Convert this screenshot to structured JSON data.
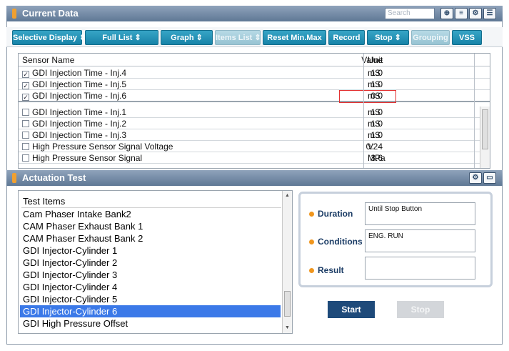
{
  "current": {
    "title": "Current Data",
    "search_placeholder": "Search",
    "icons": [
      "zoom-in-icon",
      "list-icon",
      "setup-icon",
      "layout-icon"
    ],
    "setup_glyph": "⚙",
    "buttons": {
      "selective": "Selective Display ⇕",
      "fulllist": "Full List ⇕",
      "graph": "Graph ⇕",
      "itemslist": "Items List ⇕",
      "reset": "Reset Min.Max",
      "record": "Record",
      "stop": "Stop ⇕",
      "grouping": "Grouping",
      "vss": "VSS"
    },
    "headers": {
      "sensor": "Sensor Name",
      "value": "Value",
      "unit": "Unit"
    },
    "rows": [
      {
        "checked": "✓",
        "name": "GDI Injection Time - Inj.4",
        "value": "1.0",
        "unit": "mS"
      },
      {
        "checked": "✓",
        "name": "GDI Injection Time - Inj.5",
        "value": "1.0",
        "unit": "mS"
      },
      {
        "checked": "✓",
        "name": "GDI Injection Time - Inj.6",
        "value": "0.0",
        "unit": "mS"
      },
      {
        "checked": "",
        "name": "GDI Injection Time - Inj.1",
        "value": "1.0",
        "unit": "mS"
      },
      {
        "checked": "",
        "name": "GDI Injection Time - Inj.2",
        "value": "1.0",
        "unit": "mS"
      },
      {
        "checked": "",
        "name": "GDI Injection Time - Inj.3",
        "value": "1.0",
        "unit": "mS"
      },
      {
        "checked": "",
        "name": "High Pressure Sensor Signal Voltage",
        "value": "0.24",
        "unit": "V"
      },
      {
        "checked": "",
        "name": "High Pressure Sensor Signal",
        "value": "3.6",
        "unit": "MPa"
      }
    ],
    "highlight_color": "#e23030"
  },
  "actuation": {
    "title": "Actuation Test",
    "list_header": "Test Items",
    "items": [
      "Cam Phaser Intake Bank2",
      "CAM Phaser Exhaust Bank 1",
      "CAM Phaser Exhaust Bank 2",
      "GDI Injector-Cylinder 1",
      "GDI Injector-Cylinder 2",
      "GDI Injector-Cylinder 3",
      "GDI Injector-Cylinder 4",
      "GDI Injector-Cylinder 5",
      "GDI Injector-Cylinder 6",
      "GDI High Pressure Offset"
    ],
    "selected_index": 8,
    "duration_label": "Duration",
    "duration_value": "Until Stop Button",
    "conditions_label": "Conditions",
    "conditions_value": "ENG. RUN",
    "result_label": "Result",
    "result_value": "",
    "start": "Start",
    "stop": "Stop"
  }
}
